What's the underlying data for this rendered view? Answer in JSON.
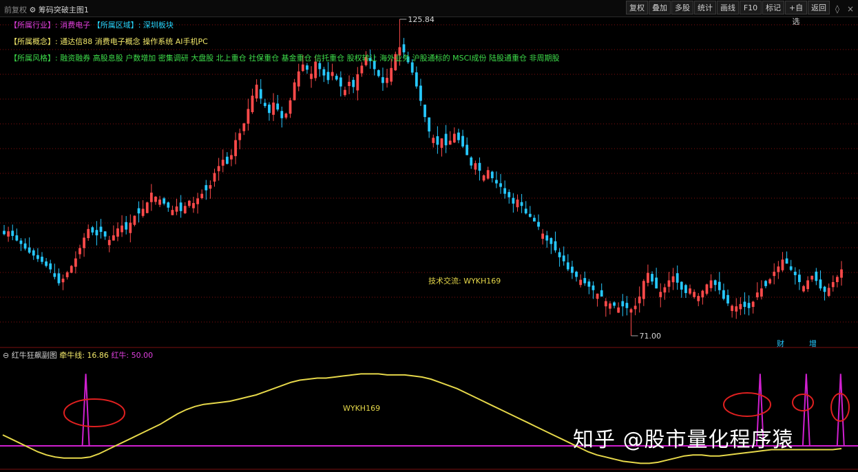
{
  "window": {
    "title_prefix": "前复权",
    "title_main": "筹码突破主图1"
  },
  "toolbar_right": [
    "复权",
    "叠加",
    "多股",
    "统计",
    "画线",
    "F10",
    "标记",
    "+自选",
    "返回"
  ],
  "info_rows": [
    {
      "segments": [
        {
          "text": "【所属行业】: ",
          "color": "mag"
        },
        {
          "text": "消费电子",
          "color": "mag"
        },
        {
          "text": "    【所属区域】: ",
          "color": "cyan"
        },
        {
          "text": "深圳板块",
          "color": "cyan"
        }
      ]
    },
    {
      "segments": [
        {
          "text": "【所属概念】: ",
          "color": "yel"
        },
        {
          "text": "通达信88 消费电子概念 操作系统 AI手机PC",
          "color": "yel"
        }
      ]
    },
    {
      "segments": [
        {
          "text": "【所属风格】: ",
          "color": "grn"
        },
        {
          "text": "融资融券 高股息股 户数增加 密集调研 大盘股 北上重仓 社保重仓 基金重仓 信托重仓 股权转让 海外业务 沪股通标的 MSCI成份 陆股通重仓 非周期股",
          "color": "grn"
        }
      ]
    }
  ],
  "colors": {
    "up": "#ff4a4a",
    "down": "#26c8ff",
    "baseline": "#d020d0",
    "line": "#e6d84a",
    "circle": "#e02020",
    "grid": "#8a1010"
  },
  "annotations": {
    "high_label": "125.84",
    "low_label": "71.00",
    "tech_text": "技术交流: WYKH169",
    "sub_center_text": "WYKH169",
    "markers": [
      "财",
      "增"
    ]
  },
  "sub_panel": {
    "name": "红牛狂飙副图",
    "line_label": "牵牛线:",
    "line_value": "16.86",
    "bull_label": "红牛:",
    "bull_value": "50.00"
  },
  "watermark": "知乎 @股市量化程序猿",
  "chart_data": [
    {
      "type": "candlestick",
      "title": "筹码突破主图1",
      "ylim": [
        71.0,
        125.84
      ],
      "high": 125.84,
      "low": 71.0,
      "close_series": [
        88.6,
        89.1,
        88.3,
        87.5,
        86.9,
        86.1,
        85.4,
        84.9,
        84.3,
        83.8,
        83.1,
        82.5,
        81.2,
        80.1,
        80.9,
        82.0,
        83.1,
        84.4,
        86.2,
        88.0,
        89.5,
        88.9,
        88.4,
        89.0,
        88.2,
        87.6,
        88.4,
        89.6,
        90.1,
        89.4,
        90.6,
        91.8,
        92.2,
        93.0,
        94.1,
        95.8,
        95.1,
        94.6,
        93.9,
        93.2,
        92.8,
        93.4,
        92.6,
        93.5,
        94.4,
        94.0,
        94.8,
        95.6,
        96.2,
        97.1,
        99.2,
        100.4,
        101.5,
        100.8,
        102.3,
        104.9,
        106.1,
        107.8,
        110.3,
        112.6,
        114.5,
        112.1,
        110.8,
        109.6,
        111.4,
        110.2,
        108.7,
        109.5,
        111.8,
        114.9,
        116.8,
        118.0,
        117.1,
        116.4,
        118.5,
        117.2,
        116.1,
        115.3,
        116.7,
        115.4,
        114.2,
        113.6,
        115.0,
        114.1,
        116.3,
        117.8,
        119.3,
        118.6,
        117.2,
        116.0,
        114.8,
        115.7,
        117.4,
        119.8,
        121.0,
        120.1,
        118.4,
        116.6,
        114.2,
        111.7,
        108.9,
        106.4,
        105.3,
        104.1,
        105.2,
        104.0,
        104.8,
        106.0,
        104.9,
        103.8,
        102.3,
        100.5,
        100.9,
        99.6,
        98.8,
        99.7,
        98.3,
        97.4,
        96.8,
        95.6,
        95.0,
        93.9,
        94.6,
        93.5,
        92.2,
        91.6,
        90.8,
        89.9,
        88.7,
        87.5,
        86.9,
        85.8,
        84.6,
        83.9,
        82.5,
        81.9,
        81.2,
        80.7,
        80.1,
        79.5,
        78.9,
        78.3,
        77.8,
        77.0,
        76.6,
        76.2,
        75.9,
        76.1,
        75.8,
        75.6,
        76.2,
        77.8,
        80.5,
        81.9,
        80.4,
        79.2,
        78.6,
        79.4,
        80.6,
        81.3,
        80.2,
        79.0,
        78.4,
        79.2,
        78.6,
        77.9,
        78.8,
        79.9,
        80.6,
        79.8,
        78.9,
        77.4,
        76.6,
        76.2,
        76.1,
        76.5,
        76.0,
        75.8,
        76.9,
        78.5,
        79.2,
        79.6,
        80.8,
        82.1,
        83.0,
        84.2,
        83.5,
        82.4,
        81.5,
        80.3,
        79.6,
        80.6,
        81.4,
        80.5,
        79.2,
        78.6,
        79.3,
        80.3,
        81.2,
        82.5
      ],
      "marks": [
        "high 125.84",
        "low 71.00"
      ]
    },
    {
      "type": "line",
      "title": "红牛狂飙副图",
      "series": [
        {
          "name": "牵牛线",
          "last_value": 16.86
        },
        {
          "name": "红牛",
          "last_value": 50.0
        }
      ],
      "line_values": [
        30,
        26,
        22,
        18,
        14,
        11,
        9,
        8,
        8,
        8,
        9,
        12,
        16,
        20,
        24,
        28,
        32,
        36,
        40,
        45,
        50,
        54,
        57,
        59,
        60,
        61,
        62,
        64,
        66,
        68,
        71,
        74,
        77,
        80,
        82,
        83,
        84,
        84,
        85,
        86,
        87,
        88,
        88,
        88,
        87,
        87,
        87,
        86,
        85,
        83,
        80,
        77,
        74,
        70,
        66,
        62,
        58,
        54,
        50,
        46,
        42,
        38,
        34,
        30,
        26,
        22,
        18,
        14,
        11,
        9,
        7,
        5,
        4,
        3,
        3,
        4,
        6,
        8,
        10,
        11,
        11,
        10,
        10,
        11,
        12,
        13,
        14,
        15,
        16,
        16,
        16,
        16,
        16,
        16,
        16,
        16,
        17
      ],
      "bull_spikes": [
        {
          "index_fraction": 0.099,
          "value": 50
        },
        {
          "index_fraction": 0.903,
          "value": 50
        },
        {
          "index_fraction": 0.958,
          "value": 50
        },
        {
          "index_fraction": 0.999,
          "value": 50
        }
      ]
    }
  ]
}
